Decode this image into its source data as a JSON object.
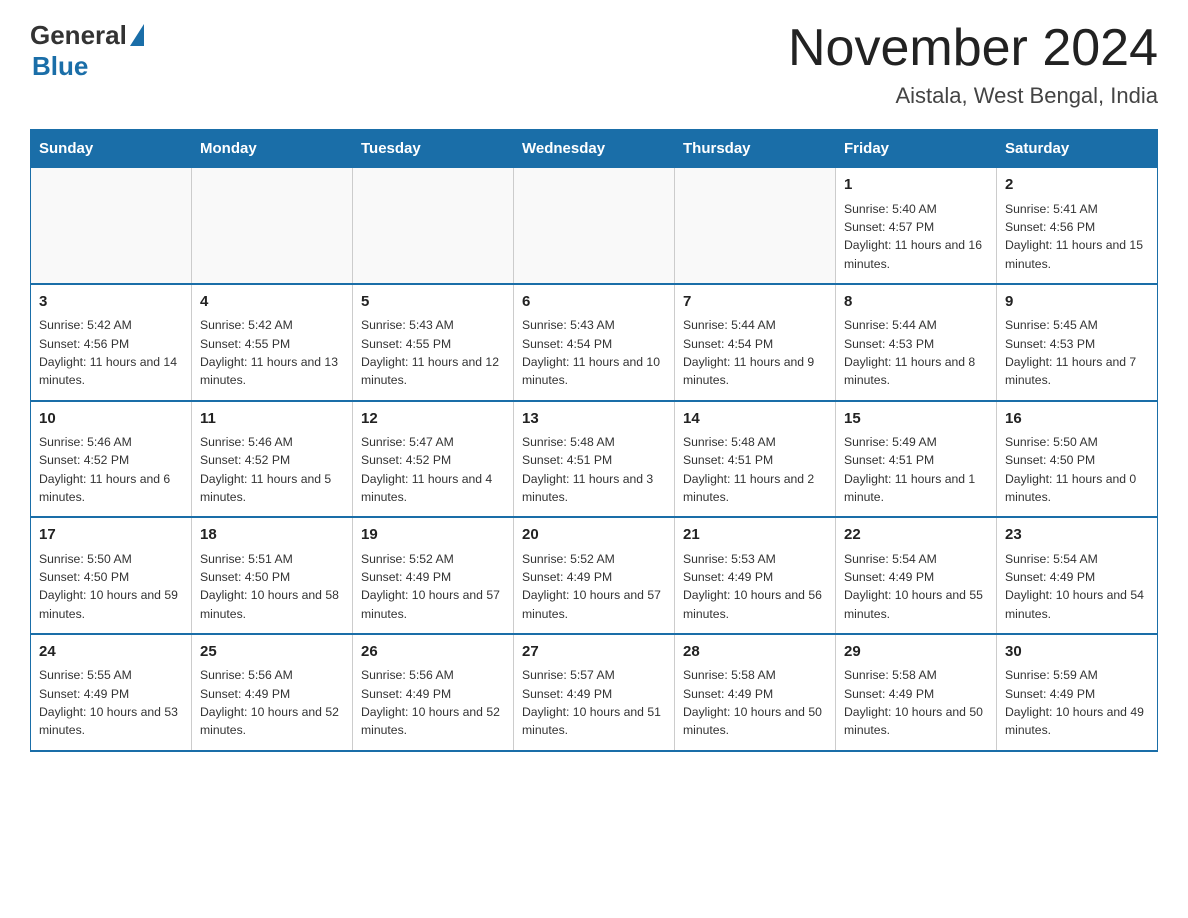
{
  "header": {
    "logo_general": "General",
    "logo_blue": "Blue",
    "month_title": "November 2024",
    "location": "Aistala, West Bengal, India"
  },
  "days_of_week": [
    "Sunday",
    "Monday",
    "Tuesday",
    "Wednesday",
    "Thursday",
    "Friday",
    "Saturday"
  ],
  "weeks": [
    [
      {
        "day": "",
        "info": ""
      },
      {
        "day": "",
        "info": ""
      },
      {
        "day": "",
        "info": ""
      },
      {
        "day": "",
        "info": ""
      },
      {
        "day": "",
        "info": ""
      },
      {
        "day": "1",
        "info": "Sunrise: 5:40 AM\nSunset: 4:57 PM\nDaylight: 11 hours and 16 minutes."
      },
      {
        "day": "2",
        "info": "Sunrise: 5:41 AM\nSunset: 4:56 PM\nDaylight: 11 hours and 15 minutes."
      }
    ],
    [
      {
        "day": "3",
        "info": "Sunrise: 5:42 AM\nSunset: 4:56 PM\nDaylight: 11 hours and 14 minutes."
      },
      {
        "day": "4",
        "info": "Sunrise: 5:42 AM\nSunset: 4:55 PM\nDaylight: 11 hours and 13 minutes."
      },
      {
        "day": "5",
        "info": "Sunrise: 5:43 AM\nSunset: 4:55 PM\nDaylight: 11 hours and 12 minutes."
      },
      {
        "day": "6",
        "info": "Sunrise: 5:43 AM\nSunset: 4:54 PM\nDaylight: 11 hours and 10 minutes."
      },
      {
        "day": "7",
        "info": "Sunrise: 5:44 AM\nSunset: 4:54 PM\nDaylight: 11 hours and 9 minutes."
      },
      {
        "day": "8",
        "info": "Sunrise: 5:44 AM\nSunset: 4:53 PM\nDaylight: 11 hours and 8 minutes."
      },
      {
        "day": "9",
        "info": "Sunrise: 5:45 AM\nSunset: 4:53 PM\nDaylight: 11 hours and 7 minutes."
      }
    ],
    [
      {
        "day": "10",
        "info": "Sunrise: 5:46 AM\nSunset: 4:52 PM\nDaylight: 11 hours and 6 minutes."
      },
      {
        "day": "11",
        "info": "Sunrise: 5:46 AM\nSunset: 4:52 PM\nDaylight: 11 hours and 5 minutes."
      },
      {
        "day": "12",
        "info": "Sunrise: 5:47 AM\nSunset: 4:52 PM\nDaylight: 11 hours and 4 minutes."
      },
      {
        "day": "13",
        "info": "Sunrise: 5:48 AM\nSunset: 4:51 PM\nDaylight: 11 hours and 3 minutes."
      },
      {
        "day": "14",
        "info": "Sunrise: 5:48 AM\nSunset: 4:51 PM\nDaylight: 11 hours and 2 minutes."
      },
      {
        "day": "15",
        "info": "Sunrise: 5:49 AM\nSunset: 4:51 PM\nDaylight: 11 hours and 1 minute."
      },
      {
        "day": "16",
        "info": "Sunrise: 5:50 AM\nSunset: 4:50 PM\nDaylight: 11 hours and 0 minutes."
      }
    ],
    [
      {
        "day": "17",
        "info": "Sunrise: 5:50 AM\nSunset: 4:50 PM\nDaylight: 10 hours and 59 minutes."
      },
      {
        "day": "18",
        "info": "Sunrise: 5:51 AM\nSunset: 4:50 PM\nDaylight: 10 hours and 58 minutes."
      },
      {
        "day": "19",
        "info": "Sunrise: 5:52 AM\nSunset: 4:49 PM\nDaylight: 10 hours and 57 minutes."
      },
      {
        "day": "20",
        "info": "Sunrise: 5:52 AM\nSunset: 4:49 PM\nDaylight: 10 hours and 57 minutes."
      },
      {
        "day": "21",
        "info": "Sunrise: 5:53 AM\nSunset: 4:49 PM\nDaylight: 10 hours and 56 minutes."
      },
      {
        "day": "22",
        "info": "Sunrise: 5:54 AM\nSunset: 4:49 PM\nDaylight: 10 hours and 55 minutes."
      },
      {
        "day": "23",
        "info": "Sunrise: 5:54 AM\nSunset: 4:49 PM\nDaylight: 10 hours and 54 minutes."
      }
    ],
    [
      {
        "day": "24",
        "info": "Sunrise: 5:55 AM\nSunset: 4:49 PM\nDaylight: 10 hours and 53 minutes."
      },
      {
        "day": "25",
        "info": "Sunrise: 5:56 AM\nSunset: 4:49 PM\nDaylight: 10 hours and 52 minutes."
      },
      {
        "day": "26",
        "info": "Sunrise: 5:56 AM\nSunset: 4:49 PM\nDaylight: 10 hours and 52 minutes."
      },
      {
        "day": "27",
        "info": "Sunrise: 5:57 AM\nSunset: 4:49 PM\nDaylight: 10 hours and 51 minutes."
      },
      {
        "day": "28",
        "info": "Sunrise: 5:58 AM\nSunset: 4:49 PM\nDaylight: 10 hours and 50 minutes."
      },
      {
        "day": "29",
        "info": "Sunrise: 5:58 AM\nSunset: 4:49 PM\nDaylight: 10 hours and 50 minutes."
      },
      {
        "day": "30",
        "info": "Sunrise: 5:59 AM\nSunset: 4:49 PM\nDaylight: 10 hours and 49 minutes."
      }
    ]
  ]
}
